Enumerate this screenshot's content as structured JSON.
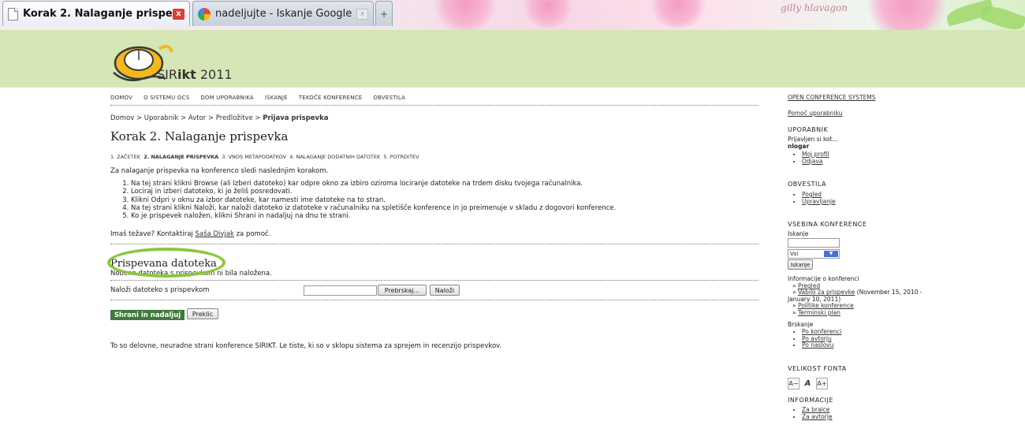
{
  "browser": {
    "active_tab_title": "Korak 2. Nalaganje prispe...",
    "inactive_tab_title": "nadeljujte - Iskanje Google",
    "new_tab_symbol": "+",
    "close_symbol": "x"
  },
  "header": {
    "logo_prefix": "SIR",
    "logo_bold": "ikt",
    "logo_year": "2011"
  },
  "nav": {
    "items": [
      "DOMOV",
      "O SISTEMU OCS",
      "DOM UPORABNIKA",
      "ISKANJE",
      "TEKOČE KONFERENCE",
      "OBVESTILA"
    ]
  },
  "breadcrumb": {
    "trail": "Domov > Uporabnik > Avtor > Predložitve > ",
    "current": "Prijava prispevka"
  },
  "page": {
    "title": "Korak 2. Nalaganje prispevka",
    "steps": {
      "s1": "1. ZAČETEK",
      "s2": "2. NALAGANJE PRISPEVKA",
      "s3": "3. VNOS METAPODATKOV",
      "s4": "4. NALAGANJE DODATNIH DATOTEK",
      "s5": "5. POTRDITEV"
    },
    "intro": "Za nalaganje prispevka na konferenco sledi naslednjim korakom.",
    "instructions": [
      "Na tej strani klikni Browse (ali Izberi datoteko) kar odpre okno za izbiro oziroma lociranje datoteke na trdem disku tvojega računalnika.",
      "Lociraj in izberi datoteko, ki jo želiš posredovati.",
      "Klikni Odpri v oknu za izbor datoteke, kar namesti ime datoteke na to stran.",
      "Na tej strani klikni Naloži, kar naloži datoteko iz datoteke v računalniku na spletišče konference in jo preimenuje v skladu z dogovori konference.",
      "Ko je prispevek naložen, klikni Shrani in nadaljuj na dnu te strani."
    ],
    "help_prefix": "Imaš težave? Kontaktiraj ",
    "help_contact": "Saša Divjak",
    "help_suffix": " za pomoč.",
    "section_title": "Prispevana datoteka",
    "no_file_text": "Nobena datoteka s prispevkom ni bila naložena.",
    "upload_label": "Naloži datoteko s prispevkom",
    "browse_label": "Prebrskaj...",
    "upload_button": "Naloži",
    "save_button": "Shrani in nadaljuj",
    "cancel_button": "Preklic",
    "footer_note": "To so delovne, neuradne strani konference SIRIKT. Le tiste, ki so v sklopu sistema za sprejem in recenzijo prispevkov."
  },
  "sidebar": {
    "ocs_link": "OPEN CONFERENCE SYSTEMS",
    "help_link": "Pomoč uporabniku",
    "user_heading": "UPORABNIK",
    "logged_in_as": "Prijavljen si kot...",
    "username": "nlogar",
    "user_links": [
      "Moj profil",
      "Odjava"
    ],
    "news_heading": "OBVESTILA",
    "news_links": [
      "Pogled",
      "Upravljanje"
    ],
    "content_heading": "VSEBINA KONFERENCE",
    "search_label": "Iskanje",
    "search_scope": "Vsi",
    "search_button": "Iskanje",
    "conf_info_heading": "Informacije o konferenci",
    "conf_info_links": [
      "Pregled",
      "Vabilo za prispevke",
      "Politike konference",
      "Terminski plan"
    ],
    "cfp_dates": " (November 15, 2010 -",
    "cfp_dates_cont": "January 10, 2011)",
    "browse_heading": "Brskanje",
    "browse_links": [
      "Po konferenci",
      "Po avtorju",
      "Po naslovu"
    ],
    "font_heading": "VELIKOST FONTA",
    "font_buttons": [
      "A−",
      "A",
      "A+"
    ],
    "info_heading": "INFORMACIJE",
    "info_links": [
      "Za bralce",
      "Za avtorje"
    ]
  }
}
